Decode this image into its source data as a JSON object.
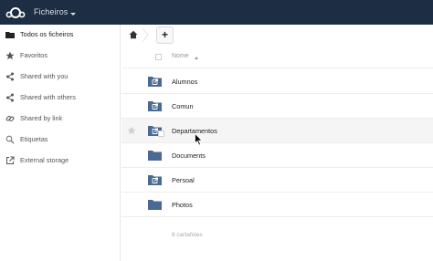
{
  "header": {
    "app_name": "Ficheiros",
    "logo_icon": "cloud-logo-icon",
    "background": "#1d2d44"
  },
  "sidebar": {
    "items": [
      {
        "label": "Todos os ficheiros",
        "icon": "folder-icon",
        "active": true
      },
      {
        "label": "Favoritos",
        "icon": "star-icon"
      },
      {
        "label": "Shared with you",
        "icon": "share-icon"
      },
      {
        "label": "Shared with others",
        "icon": "share-icon"
      },
      {
        "label": "Shared by link",
        "icon": "link-icon"
      },
      {
        "label": "Etiquetas",
        "icon": "tag-icon"
      },
      {
        "label": "External storage",
        "icon": "external-icon"
      }
    ]
  },
  "toolbar": {
    "home_icon": "home-icon",
    "add_label": "+"
  },
  "file_list": {
    "column_name": "Nome",
    "folder_color": "#4a6a93",
    "rows": [
      {
        "name": "Alumnos",
        "shared": true
      },
      {
        "name": "Comun",
        "shared": true
      },
      {
        "name": "Departamentos",
        "shared": true,
        "hover": true
      },
      {
        "name": "Documents",
        "shared": false
      },
      {
        "name": "Persoal",
        "shared": true
      },
      {
        "name": "Photos",
        "shared": false
      }
    ],
    "summary": "6 cartafoles"
  }
}
